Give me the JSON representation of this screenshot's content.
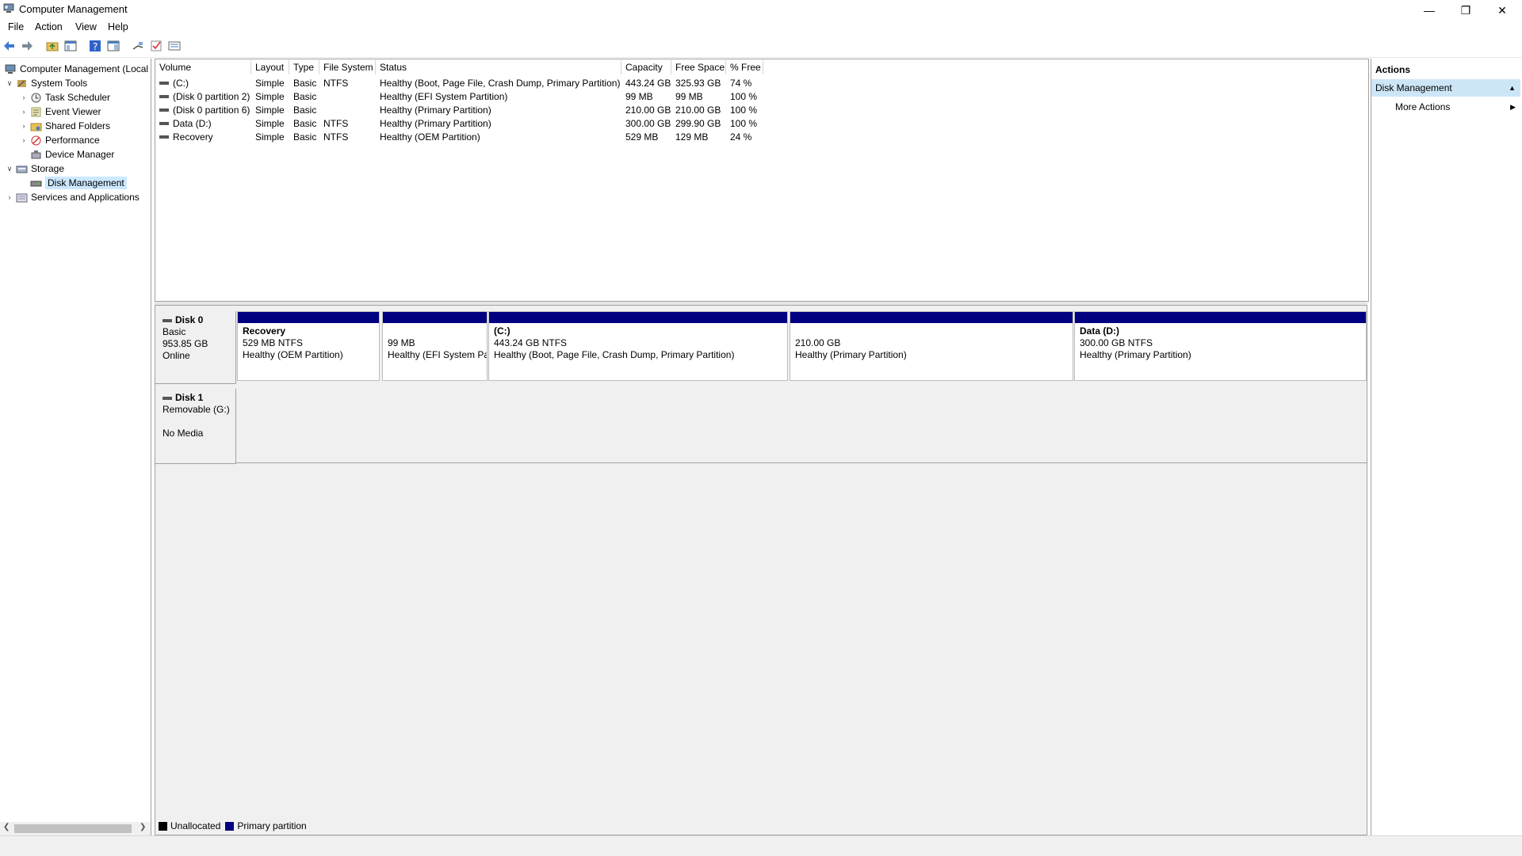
{
  "window": {
    "title": "Computer Management"
  },
  "menu": [
    "File",
    "Action",
    "View",
    "Help"
  ],
  "tree": {
    "root": "Computer Management (Local",
    "items": [
      {
        "label": "System Tools",
        "level": 1,
        "expander": "open",
        "icon": "tools-icon"
      },
      {
        "label": "Task Scheduler",
        "level": 2,
        "expander": "closed",
        "icon": "clock-icon"
      },
      {
        "label": "Event Viewer",
        "level": 2,
        "expander": "closed",
        "icon": "event-viewer-icon"
      },
      {
        "label": "Shared Folders",
        "level": 2,
        "expander": "closed",
        "icon": "shared-folder-icon"
      },
      {
        "label": "Performance",
        "level": 2,
        "expander": "closed",
        "icon": "performance-icon"
      },
      {
        "label": "Device Manager",
        "level": 2,
        "expander": "none",
        "icon": "device-manager-icon"
      },
      {
        "label": "Storage",
        "level": 1,
        "expander": "open",
        "icon": "storage-icon"
      },
      {
        "label": "Disk Management",
        "level": 2,
        "expander": "none",
        "icon": "disk-icon",
        "selected": true
      },
      {
        "label": "Services and Applications",
        "level": 1,
        "expander": "closed",
        "icon": "services-icon"
      }
    ]
  },
  "volumes": {
    "columns": [
      {
        "label": "Volume",
        "w": 121
      },
      {
        "label": "Layout",
        "w": 48
      },
      {
        "label": "Type",
        "w": 38
      },
      {
        "label": "File System",
        "w": 71
      },
      {
        "label": "Status",
        "w": 310
      },
      {
        "label": "Capacity",
        "w": 63
      },
      {
        "label": "Free Space",
        "w": 69
      },
      {
        "label": "% Free",
        "w": 47
      }
    ],
    "rows": [
      [
        "(C:)",
        "Simple",
        "Basic",
        "NTFS",
        "Healthy (Boot, Page File, Crash Dump, Primary Partition)",
        "443.24 GB",
        "325.93 GB",
        "74 %"
      ],
      [
        "(Disk 0 partition 2)",
        "Simple",
        "Basic",
        "",
        "Healthy (EFI System Partition)",
        "99 MB",
        "99 MB",
        "100 %"
      ],
      [
        "(Disk 0 partition 6)",
        "Simple",
        "Basic",
        "",
        "Healthy (Primary Partition)",
        "210.00 GB",
        "210.00 GB",
        "100 %"
      ],
      [
        "Data (D:)",
        "Simple",
        "Basic",
        "NTFS",
        "Healthy (Primary Partition)",
        "300.00 GB",
        "299.90 GB",
        "100 %"
      ],
      [
        "Recovery",
        "Simple",
        "Basic",
        "NTFS",
        "Healthy (OEM Partition)",
        "529 MB",
        "129 MB",
        "24 %"
      ]
    ]
  },
  "disks": [
    {
      "name": "Disk 0",
      "lines": [
        "Basic",
        "953.85 GB",
        "Online"
      ]
    },
    {
      "name": "Disk 1",
      "lines": [
        "Removable (G:)",
        "",
        "No Media"
      ]
    }
  ],
  "partitions": [
    {
      "title": "Recovery",
      "size": "529 MB NTFS",
      "status": "Healthy (OEM Partition)"
    },
    {
      "title": "",
      "size": "99 MB",
      "status": "Healthy (EFI System Pa"
    },
    {
      "title": "(C:)",
      "size": "443.24 GB NTFS",
      "status": "Healthy (Boot, Page File, Crash Dump, Primary Partition)"
    },
    {
      "title": "",
      "size": "210.00 GB",
      "status": "Healthy (Primary Partition)"
    },
    {
      "title": "Data  (D:)",
      "size": "300.00 GB NTFS",
      "status": "Healthy (Primary Partition)"
    }
  ],
  "legend": [
    {
      "label": "Unallocated",
      "color": "#000000"
    },
    {
      "label": "Primary partition",
      "color": "#000080"
    }
  ],
  "actions": {
    "header": "Actions",
    "section": "Disk Management",
    "more": "More Actions"
  },
  "colors": {
    "accent": "#000080",
    "selection": "#cce8ff",
    "action_section": "#cde6f7"
  }
}
